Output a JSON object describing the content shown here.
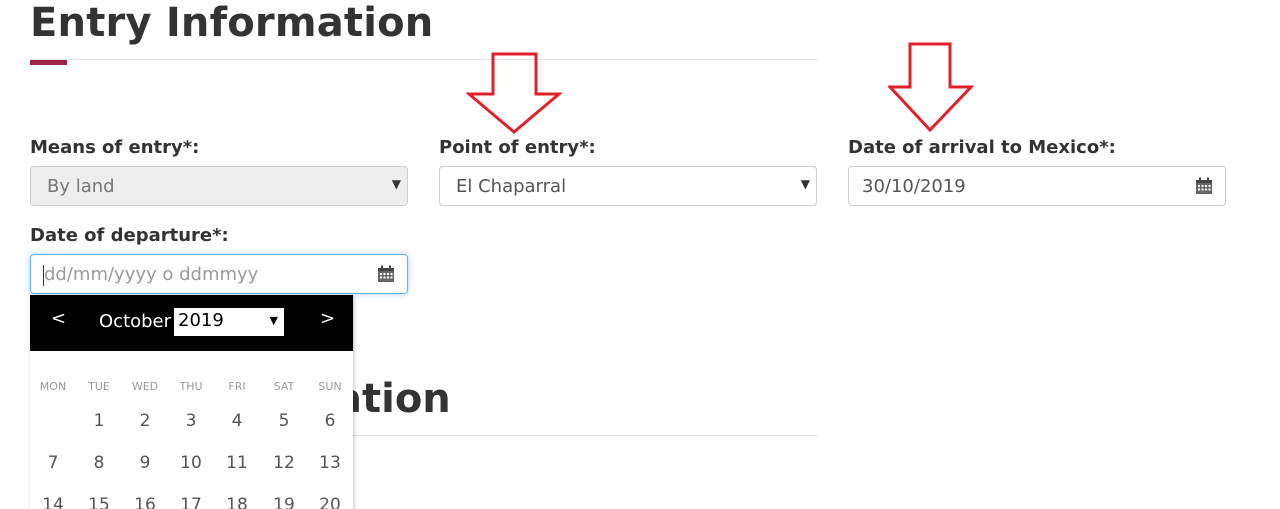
{
  "section": {
    "title": "Entry Information",
    "next_section_title_visible": "ation"
  },
  "fields": {
    "means_of_entry": {
      "label": "Means of entry*:",
      "value": "By land"
    },
    "point_of_entry": {
      "label": "Point of entry*:",
      "value": "El Chaparral"
    },
    "date_of_arrival": {
      "label": "Date of arrival to Mexico*:",
      "value": "30/10/2019"
    },
    "date_of_departure": {
      "label": "Date of departure*:",
      "placeholder": "dd/mm/yyyy o ddmmyy"
    }
  },
  "datepicker": {
    "prev": "<",
    "next": ">",
    "month": "October",
    "year": "2019",
    "weekdays": [
      "MON",
      "TUE",
      "WED",
      "THU",
      "FRI",
      "SAT",
      "SUN"
    ],
    "weeks": [
      [
        "",
        "1",
        "2",
        "3",
        "4",
        "5",
        "6"
      ],
      [
        "7",
        "8",
        "9",
        "10",
        "11",
        "12",
        "13"
      ],
      [
        "14",
        "15",
        "16",
        "17",
        "18",
        "19",
        "20"
      ]
    ]
  },
  "colors": {
    "accent": "#9d2449",
    "annotation_arrow": "#e0202a",
    "focus_border": "#66afe9"
  },
  "icons": {
    "select_caret": "▼",
    "calendar": "calendar-icon",
    "annotation": "down-arrow-annotation"
  }
}
